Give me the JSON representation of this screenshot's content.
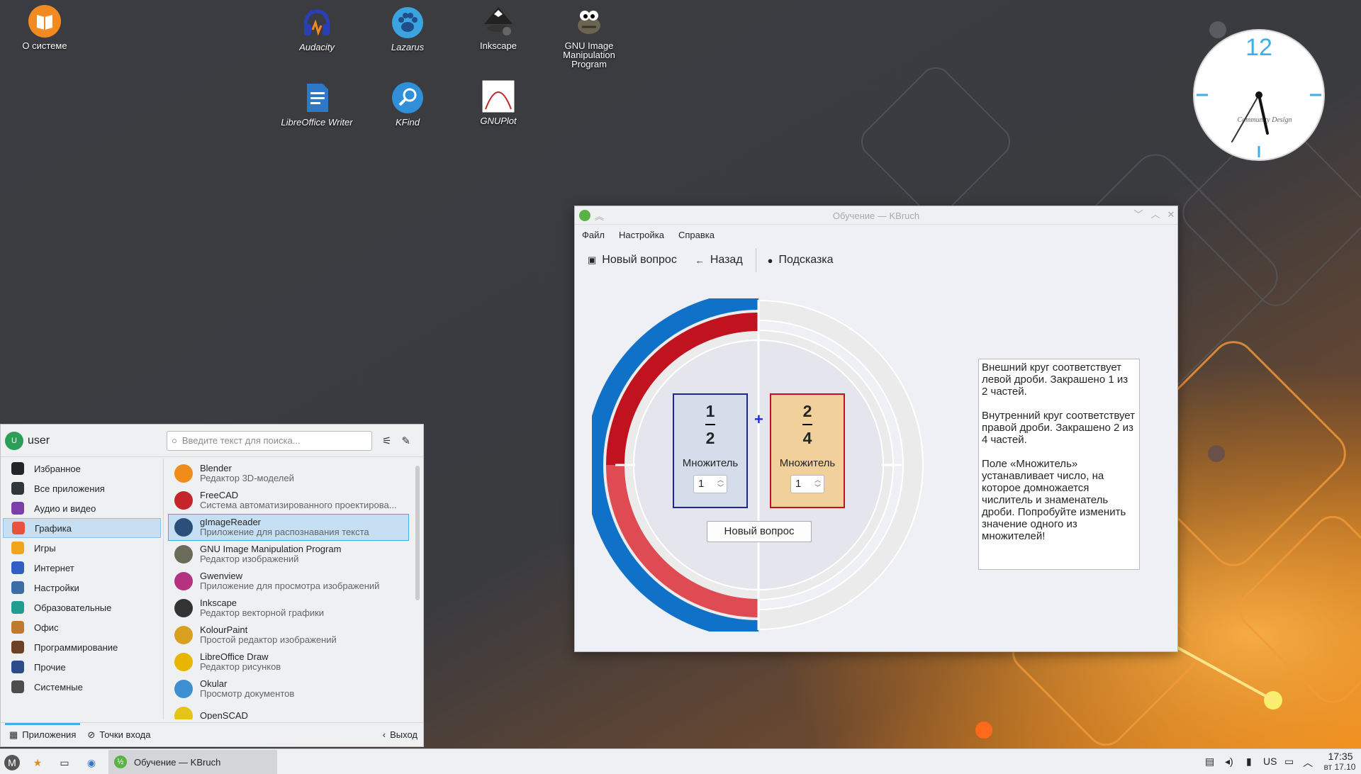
{
  "desktop": {
    "icons": [
      {
        "label": "О системе",
        "icon": "book-icon",
        "italic": false
      },
      {
        "label": "Audacity",
        "icon": "headphones-icon",
        "italic": true
      },
      {
        "label": "Lazarus",
        "icon": "paw-icon",
        "italic": true
      },
      {
        "label": "Inkscape",
        "icon": "inkscape-icon",
        "italic": false
      },
      {
        "label": "GNU Image Manipulation Program",
        "icon": "gimp-icon",
        "italic": false
      },
      {
        "label": "LibreOffice Writer",
        "icon": "document-icon",
        "italic": true
      },
      {
        "label": "KFind",
        "icon": "magnifier-icon",
        "italic": true
      },
      {
        "label": "GNUPlot",
        "icon": "plot-icon",
        "italic": true
      }
    ],
    "clock": {
      "numeral": "12",
      "brand": "Community Design"
    }
  },
  "window": {
    "title": "Обучение — KBruch",
    "menu": [
      "Файл",
      "Настройка",
      "Справка"
    ],
    "toolbar": {
      "new_question": "Новый вопрос",
      "back": "Назад",
      "hint": "Подсказка"
    },
    "left_fraction": {
      "numerator": "1",
      "denominator": "2",
      "label": "Множитель",
      "multiplier": "1"
    },
    "right_fraction": {
      "numerator": "2",
      "denominator": "4",
      "label": "Множитель",
      "multiplier": "1"
    },
    "operator": "+",
    "new_question_button": "Новый вопрос",
    "info_text": "Внешний круг соответствует левой дроби. Закрашено 1 из 2 частей.\n\nВнутренний круг соответствует правой дроби. Закрашено 2 из 4 частей.\n\nПоле «Множитель» устанавливает число, на которое домножается числитель и знаменатель дроби. Попробуйте изменить значение одного из множителей!",
    "colors": {
      "outer": "#0f72c8",
      "inner_dark": "#c0121f",
      "inner_light": "#de4b53",
      "left_box": "#1a2a8a",
      "right_box": "#c0121f",
      "right_fill": "#f2d09c"
    }
  },
  "app_menu": {
    "user": "user",
    "avatar_letter": "U",
    "search_placeholder": "Введите текст для поиска...",
    "categories": [
      {
        "label": "Избранное",
        "icon": "bookmark-icon",
        "color": "#232629",
        "selected": false
      },
      {
        "label": "Все приложения",
        "icon": "grid-icon",
        "color": "#31363b",
        "selected": false
      },
      {
        "label": "Аудио и видео",
        "icon": "multimedia-icon",
        "color": "#7a3fa8",
        "selected": false
      },
      {
        "label": "Графика",
        "icon": "palette-icon",
        "color": "#e7513e",
        "selected": true
      },
      {
        "label": "Игры",
        "icon": "gamepad-icon",
        "color": "#f1a51a",
        "selected": false
      },
      {
        "label": "Интернет",
        "icon": "globe-icon",
        "color": "#2f5ec4",
        "selected": false
      },
      {
        "label": "Настройки",
        "icon": "sliders-icon",
        "color": "#3b6ea5",
        "selected": false
      },
      {
        "label": "Образовательные",
        "icon": "atom-icon",
        "color": "#1f9d8f",
        "selected": false
      },
      {
        "label": "Офис",
        "icon": "briefcase-icon",
        "color": "#c07a2f",
        "selected": false
      },
      {
        "label": "Программирование",
        "icon": "hammer-icon",
        "color": "#6b4226",
        "selected": false
      },
      {
        "label": "Прочие",
        "icon": "dots-icon",
        "color": "#2d4c8a",
        "selected": false
      },
      {
        "label": "Системные",
        "icon": "gear-icon",
        "color": "#4d4d4d",
        "selected": false
      }
    ],
    "apps": [
      {
        "name": "Blender",
        "desc": "Редактор 3D-моделей",
        "icon": "blender-icon",
        "color": "#f08c1a",
        "selected": false
      },
      {
        "name": "FreeCAD",
        "desc": "Система автоматизированного проектирова...",
        "icon": "freecad-icon",
        "color": "#c4252a",
        "selected": false
      },
      {
        "name": "gImageReader",
        "desc": "Приложение для распознавания текста",
        "icon": "gimagereader-icon",
        "color": "#2a4f7a",
        "selected": true
      },
      {
        "name": "GNU Image Manipulation Program",
        "desc": "Редактор изображений",
        "icon": "gimp-icon",
        "color": "#6b6b5a",
        "selected": false
      },
      {
        "name": "Gwenview",
        "desc": "Приложение для просмотра изображений",
        "icon": "eye-icon",
        "color": "#b5327e",
        "selected": false
      },
      {
        "name": "Inkscape",
        "desc": "Редактор векторной графики",
        "icon": "inkscape-icon",
        "color": "#333333",
        "selected": false
      },
      {
        "name": "KolourPaint",
        "desc": "Простой редактор изображений",
        "icon": "paint-icon",
        "color": "#d9a01f",
        "selected": false
      },
      {
        "name": "LibreOffice Draw",
        "desc": "Редактор рисунков",
        "icon": "draw-icon",
        "color": "#e8b500",
        "selected": false
      },
      {
        "name": "Okular",
        "desc": "Просмотр документов",
        "icon": "okular-icon",
        "color": "#3d8fd1",
        "selected": false
      },
      {
        "name": "OpenSCAD",
        "desc": "",
        "icon": "openscad-icon",
        "color": "#e3c417",
        "selected": false
      }
    ],
    "footer": {
      "applications": "Приложения",
      "places": "Точки входа",
      "logout": "Выход"
    }
  },
  "taskbar": {
    "task": "Обучение — KBruch",
    "layout": "US",
    "time": "17:35",
    "date": "вт 17.10"
  }
}
